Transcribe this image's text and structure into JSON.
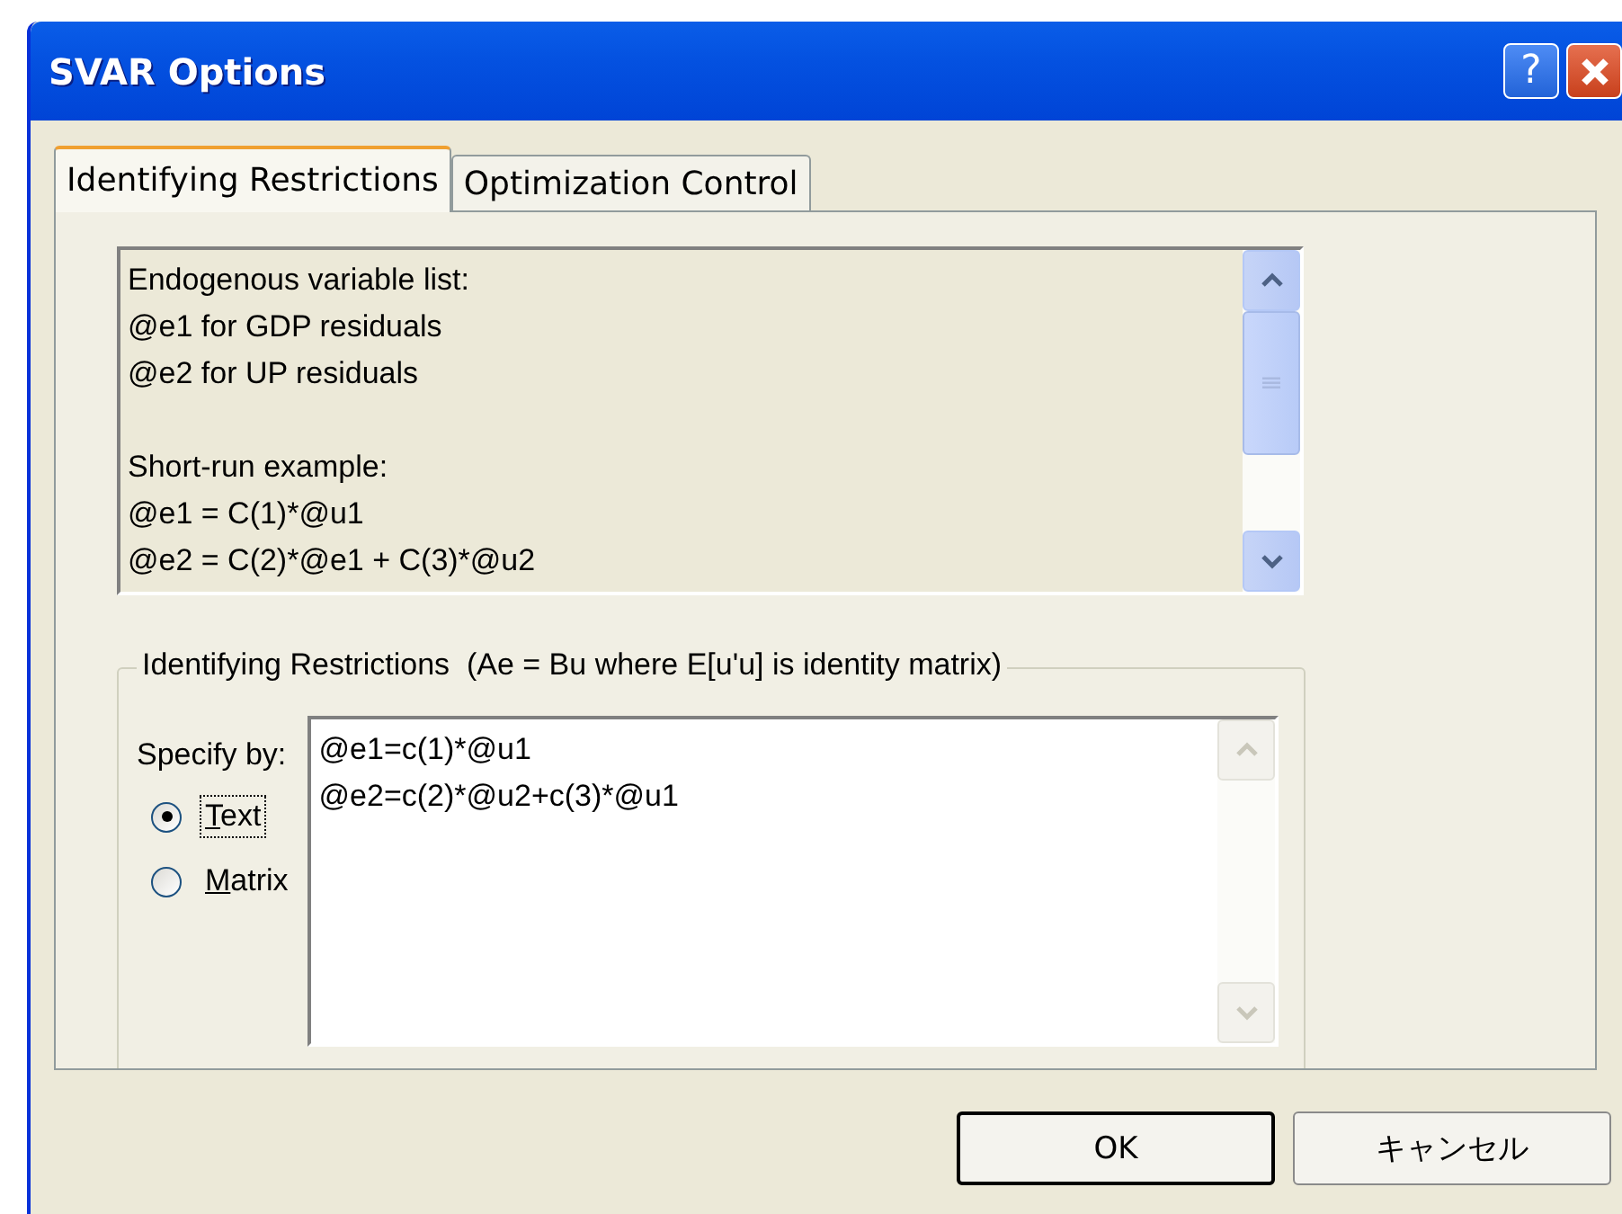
{
  "window": {
    "title": "SVAR Options",
    "help_button": "?"
  },
  "tabs": [
    {
      "label": "Identifying Restrictions",
      "selected": true
    },
    {
      "label": "Optimization Control",
      "selected": false
    }
  ],
  "info_box": {
    "paragraphs": [
      [
        "Endogenous variable list:",
        "@e1 for GDP residuals",
        "@e2 for UP residuals"
      ],
      [
        "Short-run example:",
        "@e1 = C(1)*@u1",
        "@e2 = C(2)*@e1 + C(3)*@u2"
      ]
    ]
  },
  "restrictions_group": {
    "title": "Identifying Restrictions  (Ae = Bu where E[u'u] is identity matrix)",
    "specify_label": "Specify by:",
    "options": [
      {
        "label": "Text",
        "selected": true,
        "focused": true
      },
      {
        "label": "Matrix",
        "selected": false,
        "focused": false
      }
    ],
    "text_value": [
      "@e1=c(1)*@u1",
      "@e2=c(2)*@u2+c(3)*@u1"
    ]
  },
  "buttons": [
    {
      "label": "OK",
      "default": true
    },
    {
      "label": "キャンセル",
      "default": false
    }
  ]
}
